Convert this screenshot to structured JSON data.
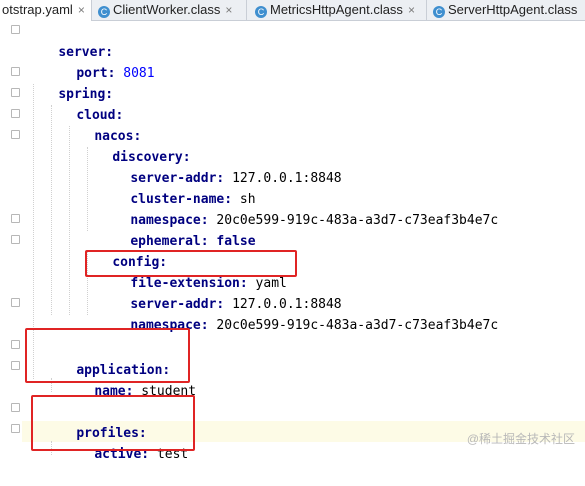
{
  "tabs": [
    {
      "label": "otstrap.yaml",
      "active": true,
      "icon": "yaml-file-icon"
    },
    {
      "label": "ClientWorker.class",
      "active": false,
      "icon": "class-file-icon"
    },
    {
      "label": "MetricsHttpAgent.class",
      "active": false,
      "icon": "class-file-icon"
    },
    {
      "label": "ServerHttpAgent.class",
      "active": false,
      "icon": "class-file-icon"
    }
  ],
  "close_glyph": "×",
  "class_icon_letter": "C",
  "code": {
    "l1": {
      "key": "server:"
    },
    "l2": {
      "key": "port:",
      "value": "8081"
    },
    "l3": {
      "key": "spring:"
    },
    "l4": {
      "key": "cloud:"
    },
    "l5": {
      "key": "nacos:"
    },
    "l6": {
      "key": "discovery:"
    },
    "l7": {
      "key": "server-addr:",
      "value": "127.0.0.1:8848"
    },
    "l8": {
      "key": "cluster-name:",
      "value": "sh"
    },
    "l9": {
      "key": "namespace:",
      "value": "20c0e599-919c-483a-a3d7-c73eaf3b4e7c"
    },
    "l10": {
      "key": "ephemeral:",
      "value": "false"
    },
    "l11": {
      "key": "config:"
    },
    "l12": {
      "key": "file-extension:",
      "value": "yaml"
    },
    "l13": {
      "key": "server-addr:",
      "value": "127.0.0.1:8848"
    },
    "l14": {
      "key": "namespace:",
      "value": "20c0e599-919c-483a-a3d7-c73eaf3b4e7c"
    },
    "l16": {
      "key": "application:"
    },
    "l17": {
      "key": "name:",
      "value": "student"
    },
    "l19": {
      "key": "profiles:"
    },
    "l20": {
      "key": "active:",
      "value": "test"
    }
  },
  "watermark": "@稀土掘金技术社区",
  "colors": {
    "key": "#000080",
    "number": "#0000ff",
    "highlight_box": "#e02424"
  }
}
